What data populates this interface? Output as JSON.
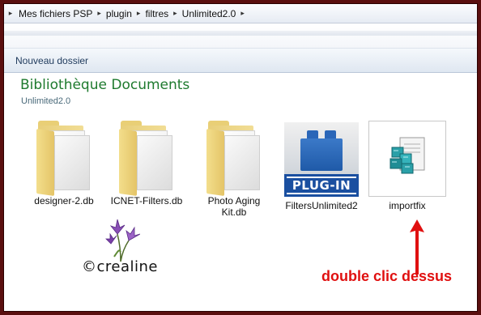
{
  "breadcrumb": {
    "items": [
      "Mes fichiers PSP",
      "plugin",
      "filtres",
      "Unlimited2.0"
    ]
  },
  "toolbar": {
    "new_folder_label": "Nouveau dossier"
  },
  "library": {
    "title": "Bibliothèque Documents",
    "subtitle": "Unlimited2.0"
  },
  "files": [
    {
      "label": "designer-2.db",
      "icon": "folder-icon"
    },
    {
      "label": "ICNET-Filters.db",
      "icon": "folder-icon"
    },
    {
      "label_line1": "Photo Aging",
      "label_line2": "Kit.db",
      "icon": "folder-icon"
    },
    {
      "label": "FiltersUnlimited2",
      "icon": "plugin-icon",
      "badge": "PLUG-IN"
    },
    {
      "label": "importfix",
      "icon": "registry-file-icon"
    }
  ],
  "annotations": {
    "copyright": "©crealine",
    "note": "double clic dessus",
    "note_color": "#e01010"
  }
}
